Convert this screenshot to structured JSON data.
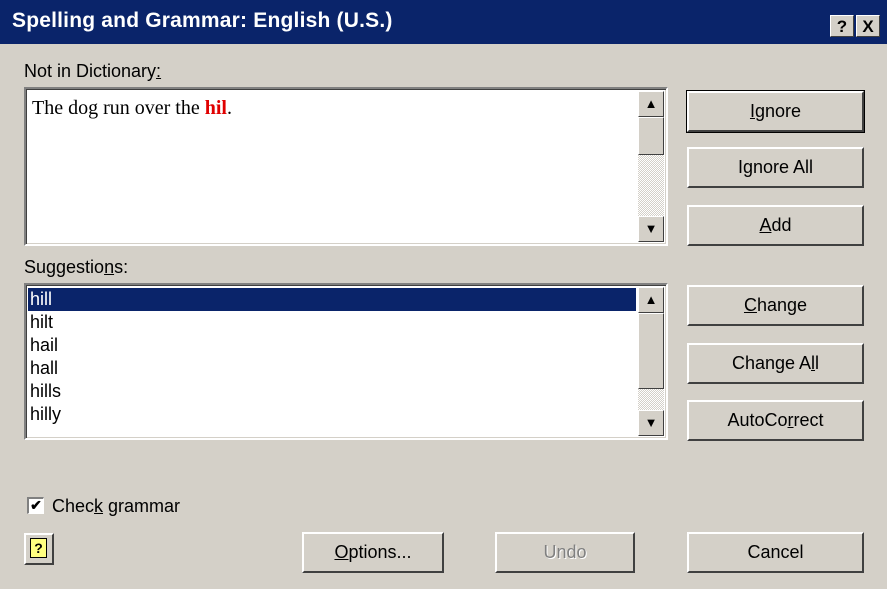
{
  "window": {
    "title": "Spelling and Grammar: English (U.S.)",
    "help_glyph": "?",
    "close_glyph": "X"
  },
  "not_in_dictionary": {
    "label_main": "Not in Dictionary",
    "label_mnemonic": ":",
    "sentence_before": "The dog run over the ",
    "error_word": "hil",
    "sentence_after": "."
  },
  "suggestions": {
    "label_before": "Suggestio",
    "label_mnemonic": "n",
    "label_after": "s:",
    "items": [
      "hill",
      "hilt",
      "hail",
      "hall",
      "hills",
      "hilly"
    ],
    "selected": "hill"
  },
  "buttons": {
    "ignore": {
      "before": "",
      "mn": "I",
      "after": "gnore"
    },
    "ignore_all": {
      "before": "I",
      "mn": "g",
      "after": "nore All"
    },
    "add": {
      "before": "",
      "mn": "A",
      "after": "dd"
    },
    "change": {
      "before": "",
      "mn": "C",
      "after": "hange"
    },
    "change_all": {
      "before": "Change A",
      "mn": "l",
      "after": "l"
    },
    "autocorrect": {
      "before": "AutoCo",
      "mn": "r",
      "after": "rect"
    },
    "options": {
      "before": "",
      "mn": "O",
      "after": "ptions..."
    },
    "undo": {
      "label": "Undo"
    },
    "cancel": {
      "label": "Cancel"
    }
  },
  "check_grammar": {
    "before": "Chec",
    "mn": "k",
    "after": " grammar",
    "checked": true,
    "check_glyph": "✔"
  },
  "help_button": {
    "glyph": "?"
  },
  "scroll_arrows": {
    "up": "▲",
    "down": "▼"
  },
  "colors": {
    "titlebar": "#0a246a",
    "error": "#e00000",
    "selection": "#0a246a",
    "face": "#d4d0c8"
  }
}
